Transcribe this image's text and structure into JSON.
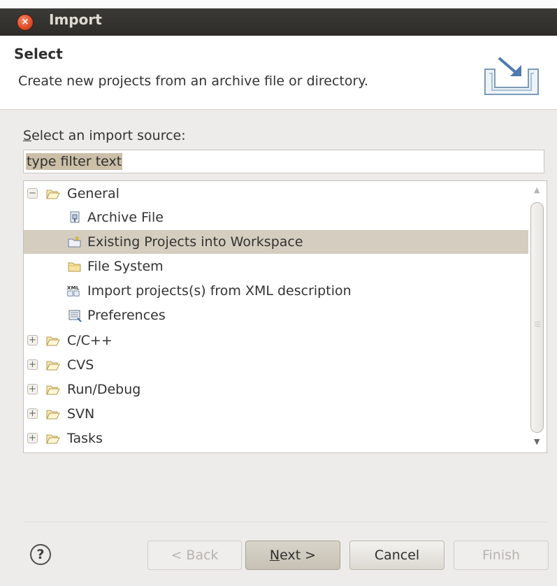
{
  "window": {
    "title": "Import"
  },
  "header": {
    "title": "Select",
    "description": "Create new projects from an archive file or directory."
  },
  "source": {
    "label_mnemonic": "S",
    "label_rest": "elect an import source:",
    "filter_value": "type filter text"
  },
  "tree": {
    "general": "General",
    "archive_file": "Archive File",
    "existing_projects": "Existing Projects into Workspace",
    "file_system": "File System",
    "import_xml": "Import projects(s) from XML description",
    "preferences": "Preferences",
    "cpp": "C/C++",
    "cvs": "CVS",
    "run_debug": "Run/Debug",
    "svn": "SVN",
    "tasks": "Tasks"
  },
  "buttons": {
    "help": "?",
    "back": "< Back",
    "next_mnemonic": "N",
    "next_rest": "ext >",
    "cancel": "Cancel",
    "finish": "Finish"
  },
  "colors": {
    "titlebar": "#2e2d29",
    "selection": "#d5cdbf",
    "close": "#de4a23"
  }
}
